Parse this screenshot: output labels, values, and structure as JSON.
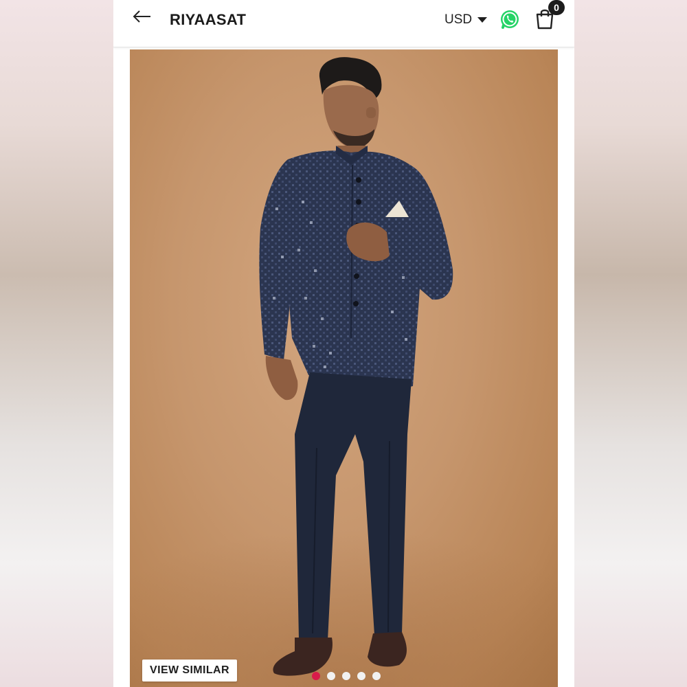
{
  "header": {
    "brand": "RIYAASAT",
    "currency": "USD",
    "cart_count": "0",
    "icons": {
      "back": "arrow-left-icon",
      "currency_caret": "caret-down-icon",
      "whatsapp": "whatsapp-icon",
      "cart": "shopping-bag-icon"
    }
  },
  "product": {
    "view_similar_label": "VIEW SIMILAR",
    "carousel": {
      "total": 5,
      "active_index": 0
    }
  },
  "colors": {
    "accent_dot": "#d81b4a",
    "whatsapp_green": "#25d366",
    "backdrop": "#c6966d",
    "suit_navy": "#2b3550"
  }
}
